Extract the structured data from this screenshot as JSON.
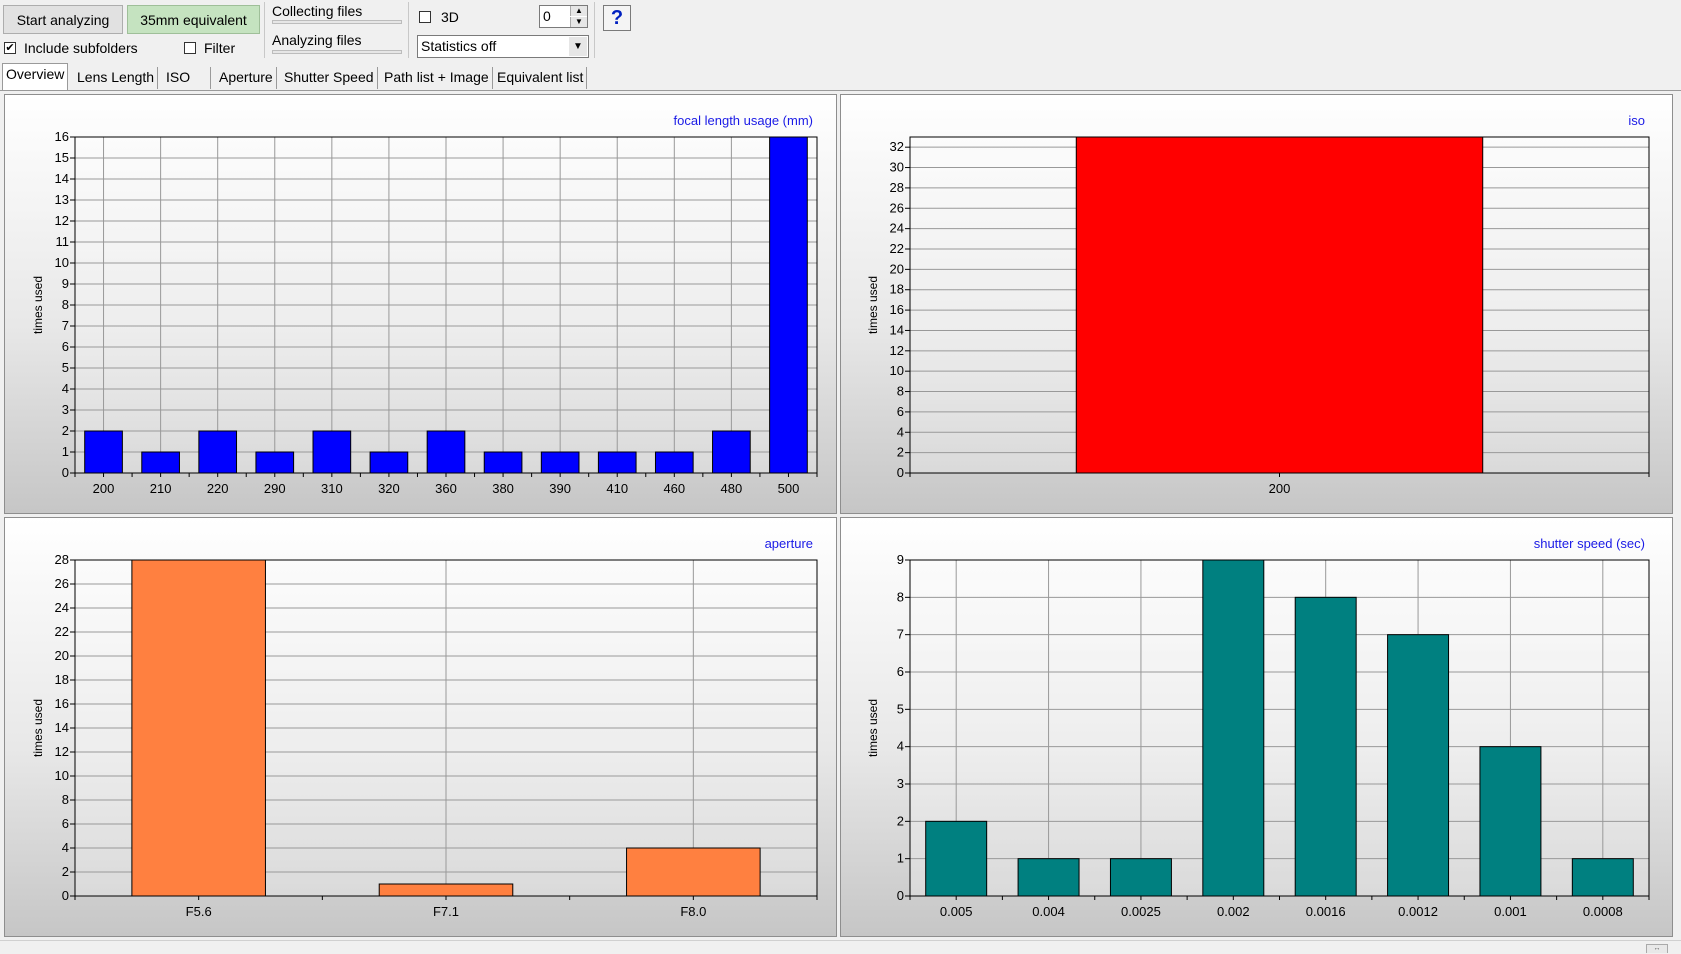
{
  "toolbar": {
    "start_label": "Start analyzing",
    "equivalent_label": "35mm equivalent",
    "include_subfolders_label": "Include subfolders",
    "include_subfolders_checked": true,
    "filter_label": "Filter",
    "filter_checked": false,
    "collecting_label": "Collecting files",
    "analyzing_label": "Analyzing files",
    "threeD_label": "3D",
    "threeD_checked": false,
    "spinner_value": "0",
    "stats_select_value": "Statistics off",
    "help_label": "?"
  },
  "tabs": [
    {
      "label": "Overview",
      "active": true
    },
    {
      "label": "Lens Length",
      "active": false
    },
    {
      "label": "ISO",
      "active": false
    },
    {
      "label": "Aperture",
      "active": false
    },
    {
      "label": "Shutter Speed",
      "active": false
    },
    {
      "label": "Path list + Image",
      "active": false
    },
    {
      "label": "Equivalent list",
      "active": false
    }
  ],
  "chart_data": [
    {
      "type": "bar",
      "title": "focal length usage (mm)",
      "ylabel": "times used",
      "xlabel": "",
      "categories": [
        "200",
        "210",
        "220",
        "290",
        "310",
        "320",
        "360",
        "380",
        "390",
        "410",
        "460",
        "480",
        "500"
      ],
      "values": [
        2,
        1,
        2,
        1,
        2,
        1,
        2,
        1,
        1,
        1,
        1,
        2,
        16
      ],
      "ylim": [
        0,
        16
      ],
      "yticks": [
        0,
        1,
        2,
        3,
        4,
        5,
        6,
        7,
        8,
        9,
        10,
        11,
        12,
        13,
        14,
        15,
        16
      ],
      "color": "#0000ff",
      "grid": true
    },
    {
      "type": "bar",
      "title": "iso",
      "ylabel": "times used",
      "xlabel": "",
      "categories": [
        "200"
      ],
      "values": [
        33
      ],
      "ylim": [
        0,
        33
      ],
      "yticks": [
        0,
        2,
        4,
        6,
        8,
        10,
        12,
        14,
        16,
        18,
        20,
        22,
        24,
        26,
        28,
        30,
        32
      ],
      "color": "#ff0000",
      "grid": true
    },
    {
      "type": "bar",
      "title": "aperture",
      "ylabel": "times used",
      "xlabel": "",
      "categories": [
        "F5.6",
        "F7.1",
        "F8.0"
      ],
      "values": [
        28,
        1,
        4
      ],
      "ylim": [
        0,
        28
      ],
      "yticks": [
        0,
        2,
        4,
        6,
        8,
        10,
        12,
        14,
        16,
        18,
        20,
        22,
        24,
        26,
        28
      ],
      "color": "#ff8040",
      "grid": true
    },
    {
      "type": "bar",
      "title": "shutter speed (sec)",
      "ylabel": "times used",
      "xlabel": "",
      "categories": [
        "0.005",
        "0.004",
        "0.0025",
        "0.002",
        "0.0016",
        "0.0012",
        "0.001",
        "0.0008"
      ],
      "values": [
        2,
        1,
        1,
        9,
        8,
        7,
        4,
        1
      ],
      "ylim": [
        0,
        9
      ],
      "yticks": [
        0,
        1,
        2,
        3,
        4,
        5,
        6,
        7,
        8,
        9
      ],
      "color": "#008080",
      "grid": true
    }
  ]
}
